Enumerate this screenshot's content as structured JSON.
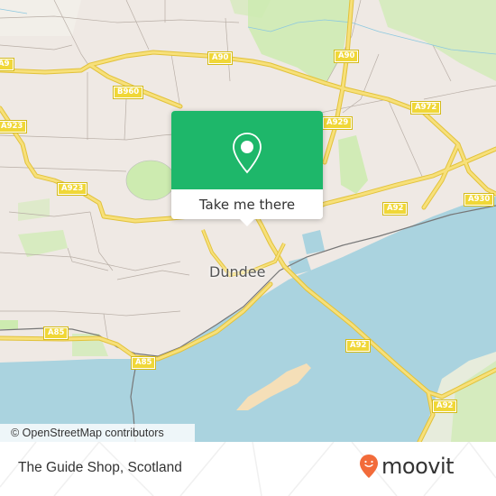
{
  "map": {
    "city_label": "Dundee",
    "colors": {
      "land": "#efe9e4",
      "water": "#aad3df",
      "park": "#cdebb0",
      "road_major": "#f7e07a",
      "road_casing": "#e2c23a",
      "shield": "#f0d737",
      "sand": "#f5dfb8",
      "rail": "#777777"
    },
    "road_shields": [
      {
        "ref": "A90",
        "label": "A90"
      },
      {
        "ref": "A90",
        "label": "A90"
      },
      {
        "ref": "A972",
        "label": "A972"
      },
      {
        "ref": "B960",
        "label": "B960"
      },
      {
        "ref": "A929",
        "label": "A929"
      },
      {
        "ref": "A923",
        "label": "A923"
      },
      {
        "ref": "A923",
        "label": "A923"
      },
      {
        "ref": "A930",
        "label": "A930"
      },
      {
        "ref": "A92",
        "label": "A92"
      },
      {
        "ref": "A92",
        "label": "A92"
      },
      {
        "ref": "A92",
        "label": "A92"
      },
      {
        "ref": "A85",
        "label": "A85"
      },
      {
        "ref": "A85",
        "label": "A85"
      },
      {
        "ref": "A90",
        "label": "A9"
      },
      {
        "ref": "A923",
        "label": "A923"
      }
    ],
    "attribution": "© OpenStreetMap contributors"
  },
  "popup": {
    "icon": "map-pin-icon",
    "button_label": "Take me there",
    "color": "#1eb76a"
  },
  "footer": {
    "place_name": "The Guide Shop, Scotland",
    "logo_text": "moovit",
    "logo_icon": "moovit-pin-icon",
    "logo_color": "#f26b3a"
  }
}
